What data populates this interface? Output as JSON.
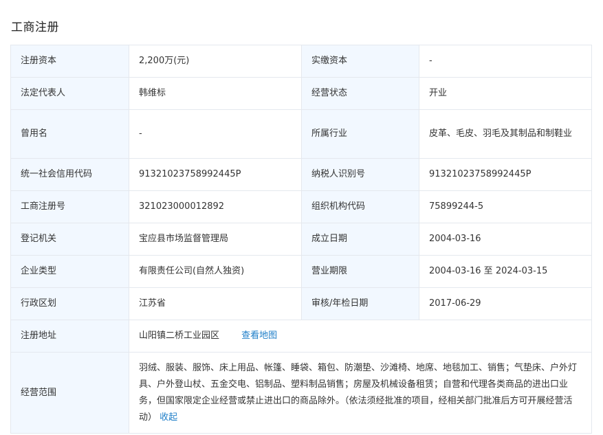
{
  "section": {
    "title": "工商注册"
  },
  "rows": {
    "r1": {
      "l1": "注册资本",
      "v1": "2,200万(元)",
      "l2": "实缴资本",
      "v2": "-"
    },
    "r2": {
      "l1": "法定代表人",
      "v1": "韩维标",
      "l2": "经营状态",
      "v2": "开业"
    },
    "r3": {
      "l1": "曾用名",
      "v1": "-",
      "l2": "所属行业",
      "v2": "皮革、毛皮、羽毛及其制品和制鞋业"
    },
    "r4": {
      "l1": "统一社会信用代码",
      "v1": "91321023758992445P",
      "l2": "纳税人识别号",
      "v2": "91321023758992445P"
    },
    "r5": {
      "l1": "工商注册号",
      "v1": "321023000012892",
      "l2": "组织机构代码",
      "v2": "75899244-5"
    },
    "r6": {
      "l1": "登记机关",
      "v1": "宝应县市场监督管理局",
      "l2": "成立日期",
      "v2": "2004-03-16"
    },
    "r7": {
      "l1": "企业类型",
      "v1": "有限责任公司(自然人独资)",
      "l2": "营业期限",
      "v2": "2004-03-16 至 2024-03-15"
    },
    "r8": {
      "l1": "行政区划",
      "v1": "江苏省",
      "l2": "审核/年检日期",
      "v2": "2017-06-29"
    }
  },
  "address": {
    "label": "注册地址",
    "value": "山阳镇二桥工业园区",
    "map_link": "查看地图"
  },
  "scope": {
    "label": "经营范围",
    "text": "羽绒、服装、服饰、床上用品、帐篷、睡袋、箱包、防潮垫、沙滩椅、地席、地毯加工、销售；气垫床、户外灯具、户外登山杖、五金交电、铝制品、塑料制品销售；房屋及机械设备租赁；自营和代理各类商品的进出口业务，但国家限定企业经营或禁止进出口的商品除外。（依法须经批准的项目，经相关部门批准后方可开展经营活动）",
    "collapse_link": "收起"
  },
  "colors": {
    "label_bg": "#f2f8ff",
    "border": "#e4e8ee",
    "link": "#1e7ec8"
  }
}
